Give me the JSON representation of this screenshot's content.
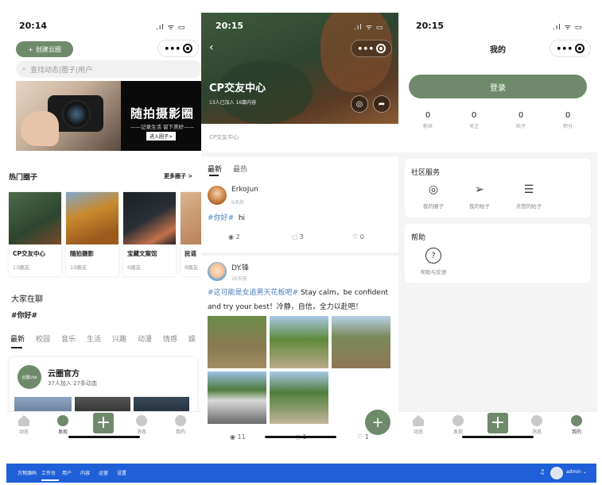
{
  "phone1": {
    "status_time": "20:14",
    "status_icons": ".ıl ᯤ ▭",
    "capsule_dots": "•••",
    "create_label": "创建云圈",
    "search_placeholder": "查找动态|圈子|用户",
    "banner_title": "随拍摄影圈",
    "banner_sub": "——记录生活 留下美好——",
    "banner_btn": "进入圈子>",
    "hot_title": "热门圈子",
    "more_label": "更多圈子 >",
    "circles": [
      {
        "name": "CP交友中心",
        "count": "13圈友",
        "color": "#3f5a3e"
      },
      {
        "name": "随拍摄影",
        "count": "19圈友",
        "color": "#c98a2e"
      },
      {
        "name": "宝藏文案馆",
        "count": "6圈友",
        "color": "#2a2f36"
      },
      {
        "name": "民谣",
        "count": "8圈友",
        "color": "#b9825a"
      }
    ],
    "chat_title": "大家在聊",
    "chat_tag": "#你好#",
    "tabs": [
      "最新",
      "校园",
      "音乐",
      "生活",
      "兴趣",
      "动漫",
      "情感",
      "娱"
    ],
    "official": {
      "avatar": "云圈Lite",
      "name": "云圈官方",
      "meta": "37人加入  27条动态"
    }
  },
  "tabbar": {
    "home": "动态",
    "discover": "发现",
    "plus": "+",
    "message": "消息",
    "mine": "我的"
  },
  "phone2": {
    "status_time": "20:15",
    "status_icons": ".ıl ᯤ ▭",
    "back": "‹",
    "title": "CP交友中心",
    "meta": "13人已加入  16篇内容",
    "desc": "CP交友中心",
    "tabs": [
      "最新",
      "最热"
    ],
    "post1": {
      "author": "ErkoJun",
      "time": "9天前",
      "hashtag": "#你好#",
      "text": "hi",
      "views": "2",
      "comments": "3",
      "likes": "0"
    },
    "post2": {
      "author": "DY.锋",
      "time": "26天前",
      "hashtag": "#这可能是女追男天花板吧#",
      "text": " Stay calm，be confident and try your best！冷静，自信，全力以赴吧！",
      "views": "11",
      "comments": "1",
      "likes": "1"
    },
    "fab": "+"
  },
  "phone3": {
    "status_time": "20:15",
    "status_icons": ".ıl ᯤ ▭",
    "header": "我的",
    "login": "登录",
    "stats": [
      {
        "num": "0",
        "label": "粉丝"
      },
      {
        "num": "0",
        "label": "关注"
      },
      {
        "num": "0",
        "label": "帖子"
      },
      {
        "num": "0",
        "label": "积分"
      }
    ],
    "service_title": "社区服务",
    "services": [
      "我的圈子",
      "我的帖子",
      "点赞的帖子"
    ],
    "help_title": "帮助",
    "help_item": "帮助与反馈"
  },
  "admin": {
    "items": [
      "万物源码",
      "工作台",
      "用户",
      "内容",
      "运营",
      "设置"
    ],
    "bell": "♫",
    "user": "admin ⌄"
  }
}
